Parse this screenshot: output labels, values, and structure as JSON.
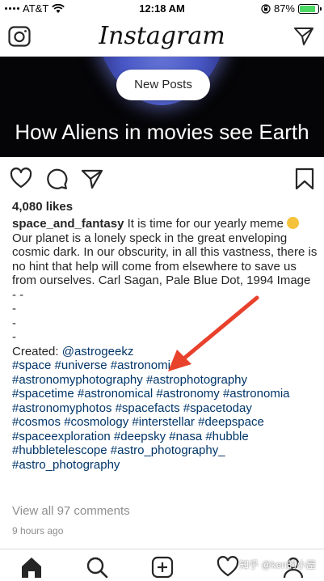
{
  "status_bar": {
    "carrier": "AT&T",
    "time": "12:18 AM",
    "battery": "87%",
    "battery_level": 0.87
  },
  "header": {
    "logo": "Instagram"
  },
  "post": {
    "new_posts_label": "New Posts",
    "image_caption": "How Aliens in movies see Earth",
    "likes": "4,080 likes",
    "username": "space_and_fantasy",
    "caption_text": "It is time for our yearly meme",
    "caption_body": "Our planet is a lonely speck in the great enveloping cosmic dark. In our obscurity, in all this vastness, there is no hint that help will come from elsewhere to save us from ourselves. Carl Sagan, Pale Blue Dot, 1994 Image",
    "separators": [
      "- -",
      "-",
      "-",
      "-"
    ],
    "created_label": "Created:",
    "created_handle": "@astrogeekz",
    "hashtag_lines": [
      "#space #universe #astronomie",
      "#astronomyphotography #astrophotography",
      "#spacetime #astronomical #astronomy #astronomia",
      "#astronomyphotos #spacefacts #spacetoday",
      "#cosmos #cosmology #interstellar #deepspace",
      "#spaceexploration #deepsky #nasa #hubble",
      "#hubbletelescope #astro_photography_",
      "#astro_photography"
    ],
    "view_comments": "View all 97 comments",
    "time_ago": "9 hours ago"
  },
  "watermark": "知乎 @ken的小屋",
  "icons": {
    "camera": "camera-icon",
    "direct": "paper-plane-icon",
    "like": "heart-icon",
    "comment": "comment-icon",
    "share": "paper-plane-icon",
    "save": "bookmark-icon",
    "home": "home-icon",
    "search": "search-icon",
    "add": "add-post-icon",
    "activity": "heart-icon",
    "profile": "profile-icon"
  },
  "colors": {
    "hashtag": "#003569",
    "arrow": "#e8412c",
    "muted": "#8e8e8e"
  }
}
